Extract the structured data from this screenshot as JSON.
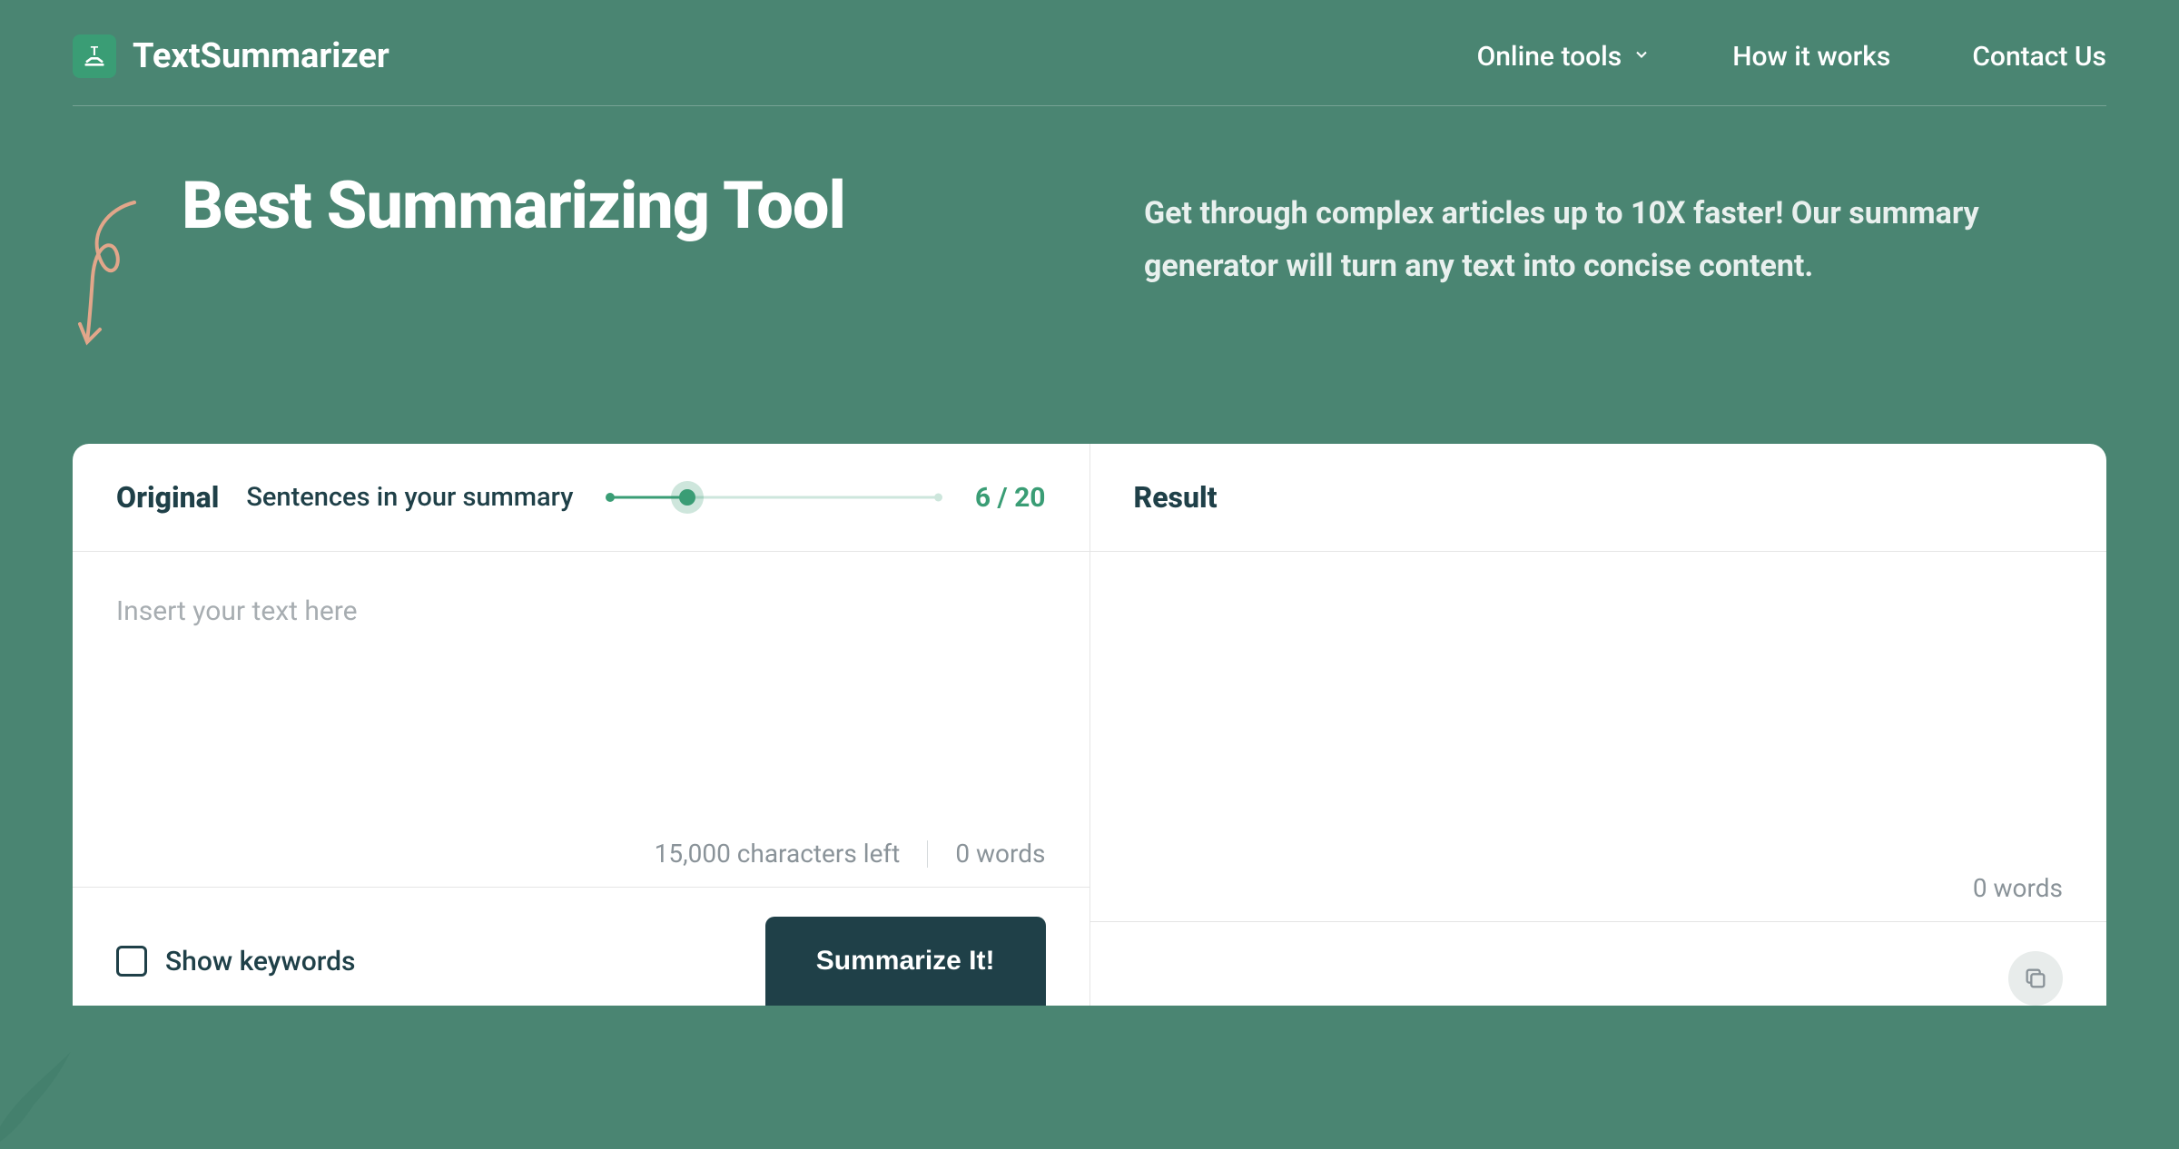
{
  "brand": "TextSummarizer",
  "nav": {
    "online_tools": "Online tools",
    "how_it_works": "How it works",
    "contact": "Contact Us"
  },
  "hero": {
    "title": "Best Summarizing Tool",
    "description": "Get through complex articles up to 10X faster! Our summary generator will turn any text into concise content."
  },
  "original": {
    "title": "Original",
    "slider_label": "Sentences in your summary",
    "slider_value": "6 / 20",
    "placeholder": "Insert your text here",
    "chars_left": "15,000 characters left",
    "word_count": "0 words",
    "show_keywords": "Show keywords",
    "cta": "Summarize It!"
  },
  "result": {
    "title": "Result",
    "word_count": "0 words"
  }
}
